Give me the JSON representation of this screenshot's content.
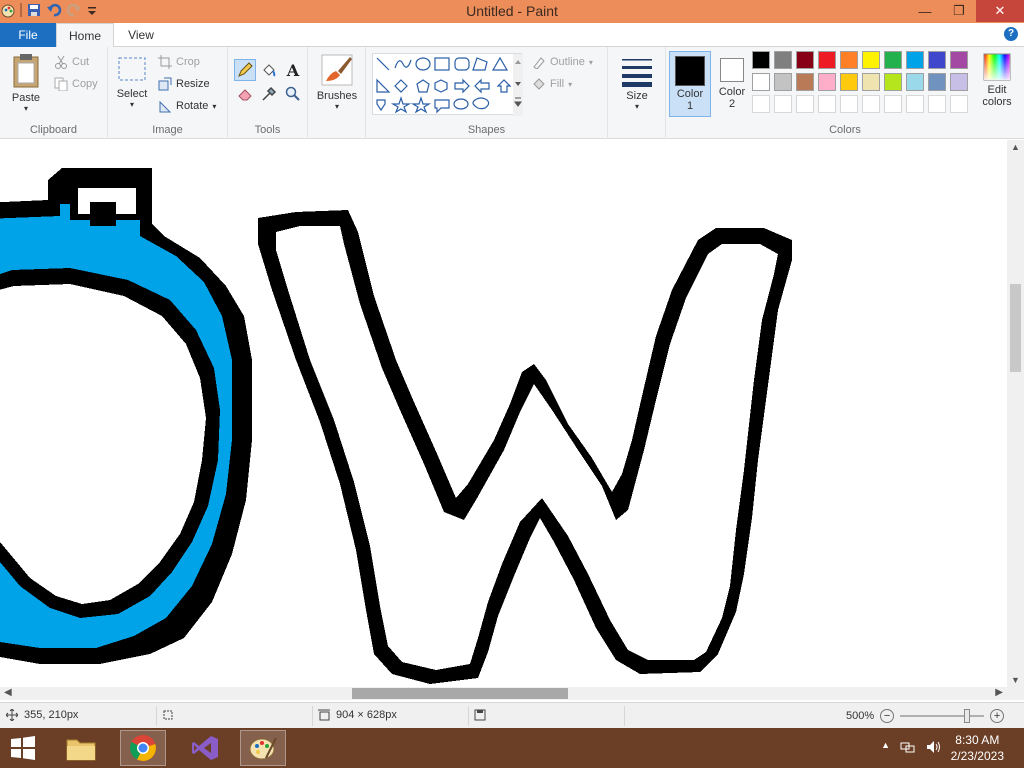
{
  "window": {
    "title": "Untitled - Paint",
    "min": "—",
    "restore": "❐",
    "close": "✕"
  },
  "tabs": {
    "file": "File",
    "home": "Home",
    "view": "View",
    "help": "?"
  },
  "clipboard": {
    "paste": "Paste",
    "cut": "Cut",
    "copy": "Copy",
    "label": "Clipboard"
  },
  "image": {
    "select": "Select",
    "crop": "Crop",
    "resize": "Resize",
    "rotate": "Rotate",
    "label": "Image"
  },
  "tools": {
    "label": "Tools",
    "text_glyph": "A"
  },
  "brushes": {
    "label": "Brushes"
  },
  "shapes": {
    "outline": "Outline",
    "fill": "Fill",
    "label": "Shapes"
  },
  "size": {
    "label": "Size"
  },
  "colors": {
    "color1_line1": "Color",
    "color1_line2": "1",
    "color2_line1": "Color",
    "color2_line2": "2",
    "edit_line1": "Edit",
    "edit_line2": "colors",
    "label": "Colors",
    "palette_row1": [
      "#000000",
      "#7f7f7f",
      "#880015",
      "#ed1c24",
      "#ff7f27",
      "#fff200",
      "#22b14c",
      "#00a2e8",
      "#3f48cc",
      "#a349a4"
    ],
    "palette_row2": [
      "#ffffff",
      "#c3c3c3",
      "#b97a57",
      "#ffaec9",
      "#ffc90e",
      "#efe4b0",
      "#b5e61d",
      "#99d9ea",
      "#7092be",
      "#c8bfe7"
    ],
    "color1": "#000000",
    "color2": "#ffffff"
  },
  "status": {
    "cursor": "355, 210px",
    "size": "904 × 628px",
    "zoom": "500%",
    "zoom_out": "−",
    "zoom_in": "+"
  },
  "taskbar": {
    "time": "8:30 AM",
    "date": "2/23/2023"
  }
}
